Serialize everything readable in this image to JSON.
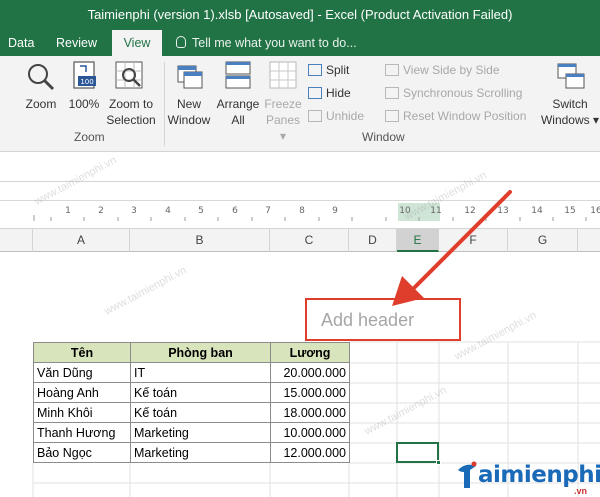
{
  "window": {
    "title": "Taimienphi (version 1).xlsb [Autosaved] - Excel (Product Activation Failed)"
  },
  "tabs": [
    {
      "label": "Data"
    },
    {
      "label": "Review"
    },
    {
      "label": "View"
    }
  ],
  "tell_me": {
    "placeholder": "Tell me what you want to do..."
  },
  "ribbon": {
    "zoom_group": {
      "label": "Zoom",
      "zoom": "Zoom",
      "zoom_100": "100%",
      "zoom_100_badge": "100",
      "zoom_to_selection_1": "Zoom to",
      "zoom_to_selection_2": "Selection"
    },
    "window_group": {
      "label": "Window",
      "new_window_1": "New",
      "new_window_2": "Window",
      "arrange_all_1": "Arrange",
      "arrange_all_2": "All",
      "freeze_panes_1": "Freeze",
      "freeze_panes_2": "Panes",
      "split": "Split",
      "hide": "Hide",
      "unhide": "Unhide",
      "view_side_by_side": "View Side by Side",
      "synchronous_scrolling": "Synchronous Scrolling",
      "reset_window_position": "Reset Window Position",
      "switch_windows_1": "Switch",
      "switch_windows_2": "Windows"
    }
  },
  "ruler": {
    "ticks": [
      "1",
      "2",
      "3",
      "4",
      "5",
      "6",
      "7",
      "8",
      "9",
      "10",
      "11",
      "12",
      "13",
      "14",
      "15",
      "16"
    ]
  },
  "columns": [
    "A",
    "B",
    "C",
    "D",
    "E",
    "F",
    "G"
  ],
  "selected_column": "E",
  "page": {
    "add_header": "Add header"
  },
  "table": {
    "headers": [
      "Tên",
      "Phòng ban",
      "Lương"
    ],
    "rows": [
      [
        "Văn Dũng",
        "IT",
        "20.000.000"
      ],
      [
        "Hoàng Anh",
        "Kế toán",
        "15.000.000"
      ],
      [
        "Minh Khôi",
        "Kế toán",
        "18.000.000"
      ],
      [
        "Thanh Hương",
        "Marketing",
        "10.000.000"
      ],
      [
        "Bảo Ngọc",
        "Marketing",
        "12.000.000"
      ]
    ]
  },
  "watermark": {
    "text": "www.taimienphi.vn"
  },
  "logo": {
    "text": "aimienphi",
    "suffix": ".vn"
  },
  "colors": {
    "accent": "#217346",
    "arrow": "#e03e2d",
    "table_header": "#d8e4bc"
  }
}
